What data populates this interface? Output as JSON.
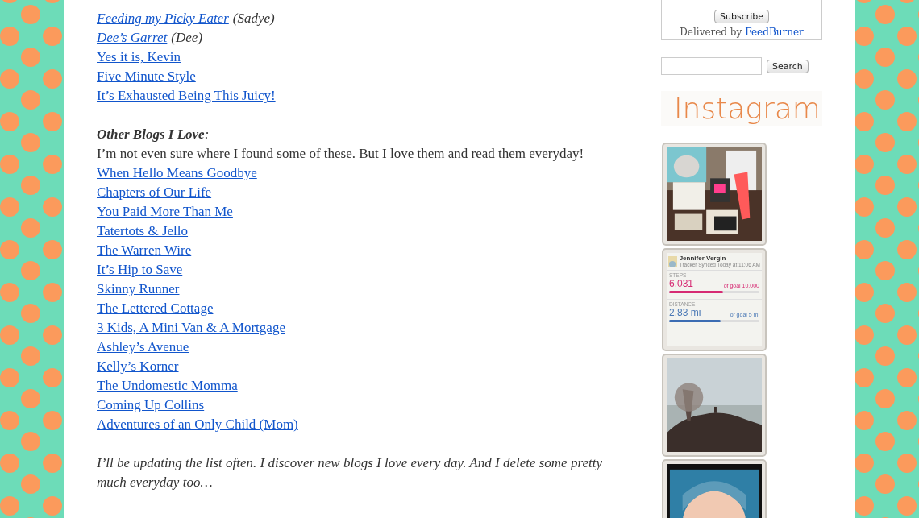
{
  "friend_blogs": [
    {
      "title": "Feeding my Picky Eater",
      "author": "(Sadye)",
      "italic": true
    },
    {
      "title": "Dee’s Garret",
      "author": "(Dee)",
      "italic": true
    },
    {
      "title": "Yes it is, Kevin",
      "italic": false
    },
    {
      "title": "Five Minute Style",
      "italic": false
    },
    {
      "title": "It’s Exhausted Being This Juicy!",
      "italic": false
    }
  ],
  "other_blogs": {
    "heading": "**Other Blogs I Love**:",
    "intro": "I’m not even sure where I found some of these. But I love them and read them everyday!",
    "links": [
      "When Hello Means Goodbye",
      "Chapters of Our Life",
      "You Paid More Than Me",
      "Tatertots & Jello",
      "The Warren Wire",
      "It’s Hip to Save",
      "Skinny Runner",
      "The Lettered Cottage",
      "3 Kids, A Mini Van & A Mortgage",
      "Ashley’s Avenue",
      "Kelly’s Korner",
      "The Undomestic Momma",
      "Coming Up Collins",
      "Adventures of an Only Child (Mom)"
    ]
  },
  "closing_note": "I’ll be updating the list often. I discover new blogs I love every day. And I delete some pretty much everyday too…",
  "sidebar": {
    "subscribe_button": "Subscribe",
    "delivered_by": "Delivered by",
    "feedburner_link": "FeedBurner",
    "search_button": "Search",
    "instagram_title": "Instagram",
    "photos": [
      {
        "kind": "still_life"
      },
      {
        "kind": "app_screenshot",
        "name": "Jennifer Vergin",
        "synced": "Tracker Synced Today at 11:06 AM",
        "steps_label": "STEPS",
        "steps": "6,031",
        "steps_goal": "of goal 10,000",
        "steps_bar": {
          "level": 0.6
        },
        "distance_label": "DISTANCE",
        "distance": "2.83 mi",
        "distance_goal": "of goal 5 mi",
        "distance_bar": {
          "level": 0.57
        }
      },
      {
        "kind": "landscape"
      },
      {
        "kind": "portrait"
      }
    ]
  }
}
